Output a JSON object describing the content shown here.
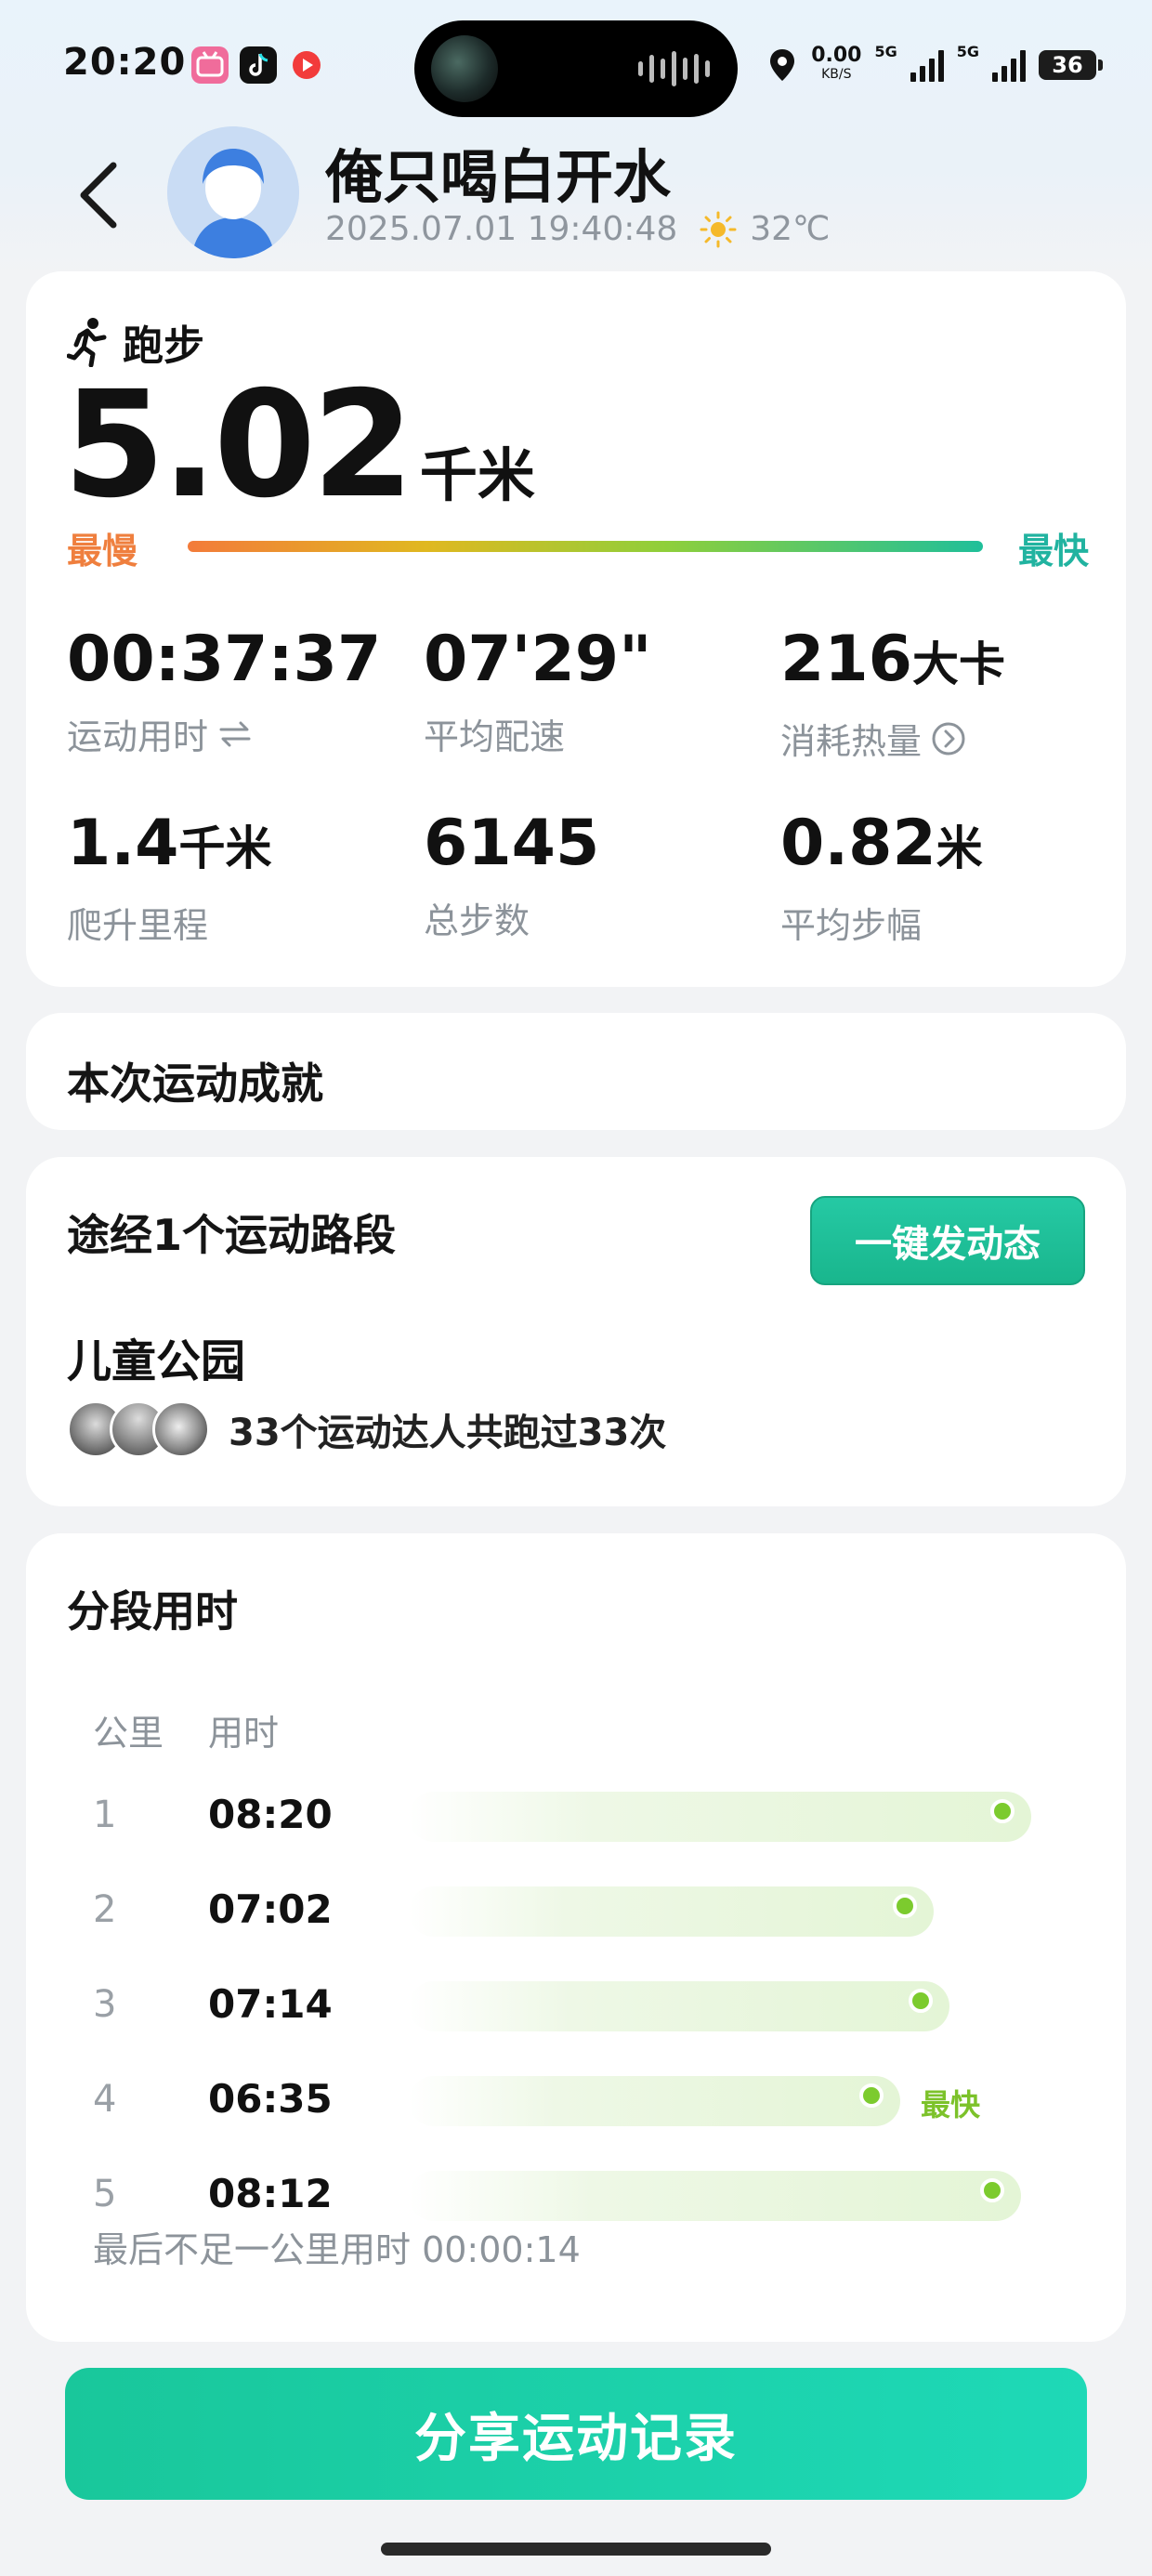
{
  "status_bar": {
    "time": "20:20",
    "net_speed": "0.00",
    "net_unit": "KB/S",
    "sim1": "5G",
    "sim2": "5G",
    "battery": "36",
    "app_icons": [
      "bilibili-icon",
      "tiktok-icon",
      "video-app-icon"
    ]
  },
  "header": {
    "username": "俺只喝白开水",
    "datetime": "2025.07.01 19:40:48",
    "temperature": "32℃",
    "weather_icon": "sun-icon"
  },
  "activity": {
    "type": "跑步",
    "distance": "5.02",
    "distance_unit": "千米",
    "slowest_label": "最慢",
    "fastest_label": "最快"
  },
  "stats": [
    {
      "value": "00:37:37",
      "unit": "",
      "label": "运动用时",
      "icon": "swap-icon"
    },
    {
      "value": "07'29\"",
      "unit": "",
      "label": "平均配速",
      "icon": ""
    },
    {
      "value": "216",
      "unit": "大卡",
      "label": "消耗热量",
      "icon": "chevron-circle-icon"
    },
    {
      "value": "1.4",
      "unit": "千米",
      "label": "爬升里程",
      "icon": ""
    },
    {
      "value": "6145",
      "unit": "",
      "label": "总步数",
      "icon": ""
    },
    {
      "value": "0.82",
      "unit": "米",
      "label": "平均步幅",
      "icon": ""
    }
  ],
  "achievements": {
    "title": "本次运动成就"
  },
  "route": {
    "title": "途经1个运动路段",
    "post_button": "一键发动态",
    "park": "儿童公园",
    "runners_text": "33个运动达人共跑过33次"
  },
  "splits": {
    "title": "分段用时",
    "col_km": "公里",
    "col_time": "用时",
    "fastest_tag": "最快",
    "rows": [
      {
        "km": "1",
        "time": "08:20",
        "seconds": 500
      },
      {
        "km": "2",
        "time": "07:02",
        "seconds": 422
      },
      {
        "km": "3",
        "time": "07:14",
        "seconds": 434
      },
      {
        "km": "4",
        "time": "06:35",
        "seconds": 395,
        "fastest": true
      },
      {
        "km": "5",
        "time": "08:12",
        "seconds": 492
      }
    ],
    "last_note": "最后不足一公里用时 00:00:14"
  },
  "share_button": "分享运动记录",
  "colors": {
    "accent": "#1fc79c",
    "slow": "#ef7f3e",
    "fast": "#21b3a0",
    "split_dot": "#7ccb2e"
  }
}
